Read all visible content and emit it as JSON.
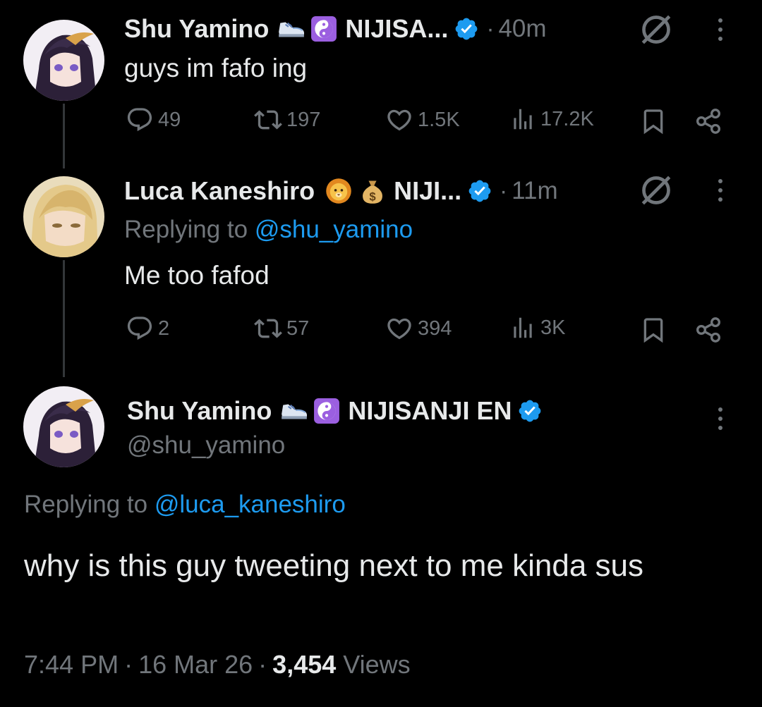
{
  "tweet1": {
    "display_name": "Shu Yamino",
    "affiliation": "NIJISA...",
    "time": "40m",
    "separator": "·",
    "text": "guys im fafo ing",
    "actions": {
      "replies": "49",
      "reposts": "197",
      "likes": "1.5K",
      "views": "17.2K"
    }
  },
  "tweet2": {
    "display_name": "Luca Kaneshiro",
    "affiliation": "NIJI...",
    "time": "11m",
    "separator": "·",
    "replying_prefix": "Replying to ",
    "replying_handle": "@shu_yamino",
    "text": "Me too fafod",
    "actions": {
      "replies": "2",
      "reposts": "57",
      "likes": "394",
      "views": "3K"
    }
  },
  "main_tweet": {
    "display_name": "Shu Yamino",
    "affiliation": "NIJISANJI EN",
    "handle": "@shu_yamino",
    "replying_prefix": "Replying to ",
    "replying_handle": "@luca_kaneshiro",
    "text": "why is this guy tweeting next to me kinda sus",
    "time": "7:44 PM",
    "date": "16 Mar 26",
    "view_count": "3,454",
    "views_label": "Views",
    "separator": "·"
  },
  "colors": {
    "background": "#000000",
    "text": "#e7e9ea",
    "muted": "#71767b",
    "link": "#1d9bf0",
    "verified": "#1d9bf0"
  },
  "icons": [
    "reply-icon",
    "repost-icon",
    "like-icon",
    "views-icon",
    "bookmark-icon",
    "share-icon",
    "more-icon",
    "verified-icon",
    "no-sign-icon",
    "shoe-emoji",
    "yin-yang-emoji",
    "lion-emoji",
    "money-bag-emoji"
  ]
}
